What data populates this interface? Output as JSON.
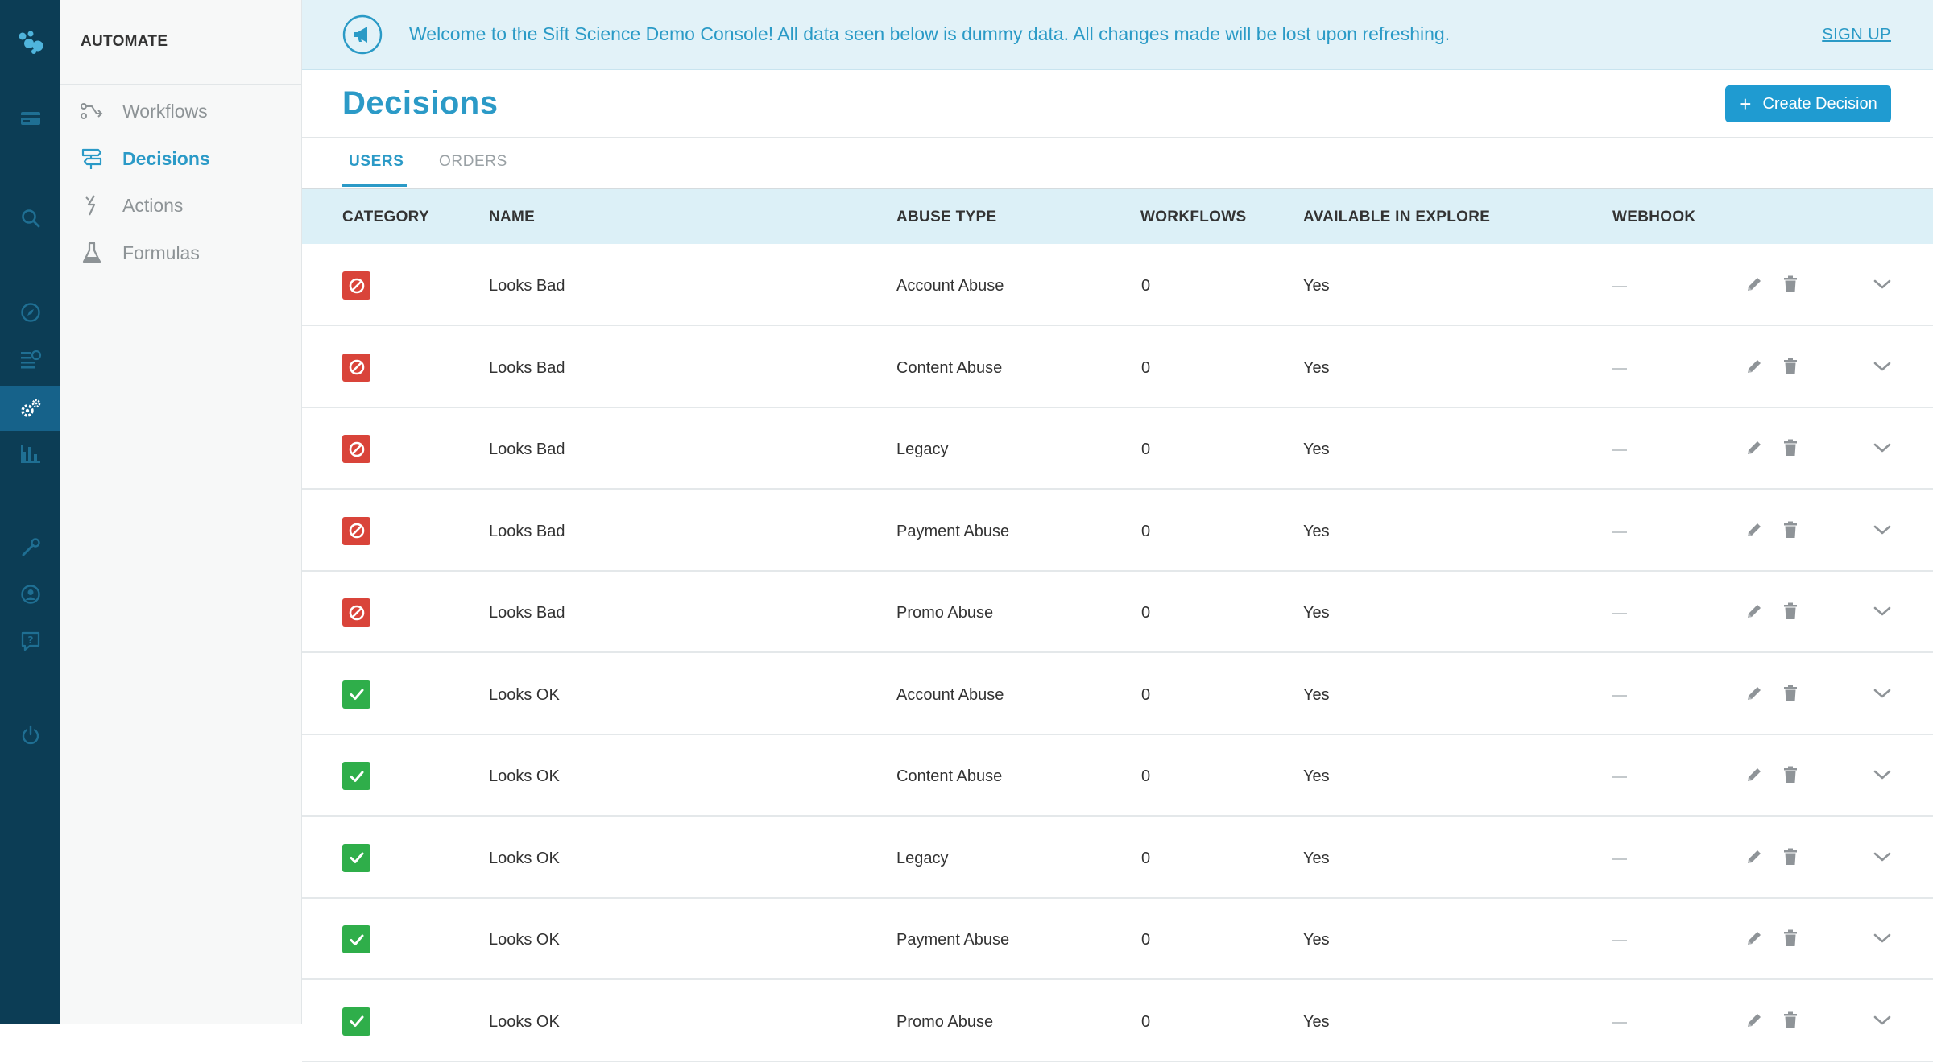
{
  "banner": {
    "text": "Welcome to the Sift Science Demo Console! All data seen below is dummy data. All changes made will be lost upon refreshing.",
    "signup_label": "SIGN UP"
  },
  "sidebar": {
    "section_title": "AUTOMATE",
    "items": [
      {
        "label": "Workflows",
        "icon": "workflow-icon",
        "active": false
      },
      {
        "label": "Decisions",
        "icon": "decision-signpost-icon",
        "active": true
      },
      {
        "label": "Actions",
        "icon": "lightning-icon",
        "active": false
      },
      {
        "label": "Formulas",
        "icon": "flask-icon",
        "active": false
      }
    ]
  },
  "rail": {
    "icons": [
      "sift-logo-icon",
      "card-icon",
      "search-icon",
      "compass-icon",
      "list-icon",
      "settings-icon",
      "bar-chart-icon",
      "wrench-icon",
      "user-icon",
      "help-icon",
      "power-icon"
    ],
    "active": "settings-icon"
  },
  "page": {
    "title": "Decisions",
    "create_button_label": "Create Decision",
    "create_button_icon": "plus-icon"
  },
  "tabs": [
    {
      "label": "USERS",
      "active": true
    },
    {
      "label": "ORDERS",
      "active": false
    }
  ],
  "table": {
    "headers": {
      "category": "CATEGORY",
      "name": "NAME",
      "abuse_type": "ABUSE TYPE",
      "workflows": "WORKFLOWS",
      "available": "AVAILABLE IN EXPLORE",
      "webhook": "WEBHOOK"
    },
    "rows": [
      {
        "category": "block",
        "name": "Looks Bad",
        "abuse_type": "Account Abuse",
        "workflows": "0",
        "available": "Yes"
      },
      {
        "category": "block",
        "name": "Looks Bad",
        "abuse_type": "Content Abuse",
        "workflows": "0",
        "available": "Yes"
      },
      {
        "category": "block",
        "name": "Looks Bad",
        "abuse_type": "Legacy",
        "workflows": "0",
        "available": "Yes"
      },
      {
        "category": "block",
        "name": "Looks Bad",
        "abuse_type": "Payment Abuse",
        "workflows": "0",
        "available": "Yes"
      },
      {
        "category": "block",
        "name": "Looks Bad",
        "abuse_type": "Promo Abuse",
        "workflows": "0",
        "available": "Yes"
      },
      {
        "category": "accept",
        "name": "Looks OK",
        "abuse_type": "Account Abuse",
        "workflows": "0",
        "available": "Yes"
      },
      {
        "category": "accept",
        "name": "Looks OK",
        "abuse_type": "Content Abuse",
        "workflows": "0",
        "available": "Yes"
      },
      {
        "category": "accept",
        "name": "Looks OK",
        "abuse_type": "Legacy",
        "workflows": "0",
        "available": "Yes"
      },
      {
        "category": "accept",
        "name": "Looks OK",
        "abuse_type": "Payment Abuse",
        "workflows": "0",
        "available": "Yes"
      },
      {
        "category": "accept",
        "name": "Looks OK",
        "abuse_type": "Promo Abuse",
        "workflows": "0",
        "available": "Yes"
      }
    ]
  },
  "colors": {
    "rail": "#0c3d55",
    "accent": "#2b9ac7",
    "button": "#1f9bd1",
    "bad": "#d9443a",
    "ok": "#2fae4a",
    "banner_bg": "#e2f2f8",
    "table_header_bg": "#dcf0f7"
  }
}
